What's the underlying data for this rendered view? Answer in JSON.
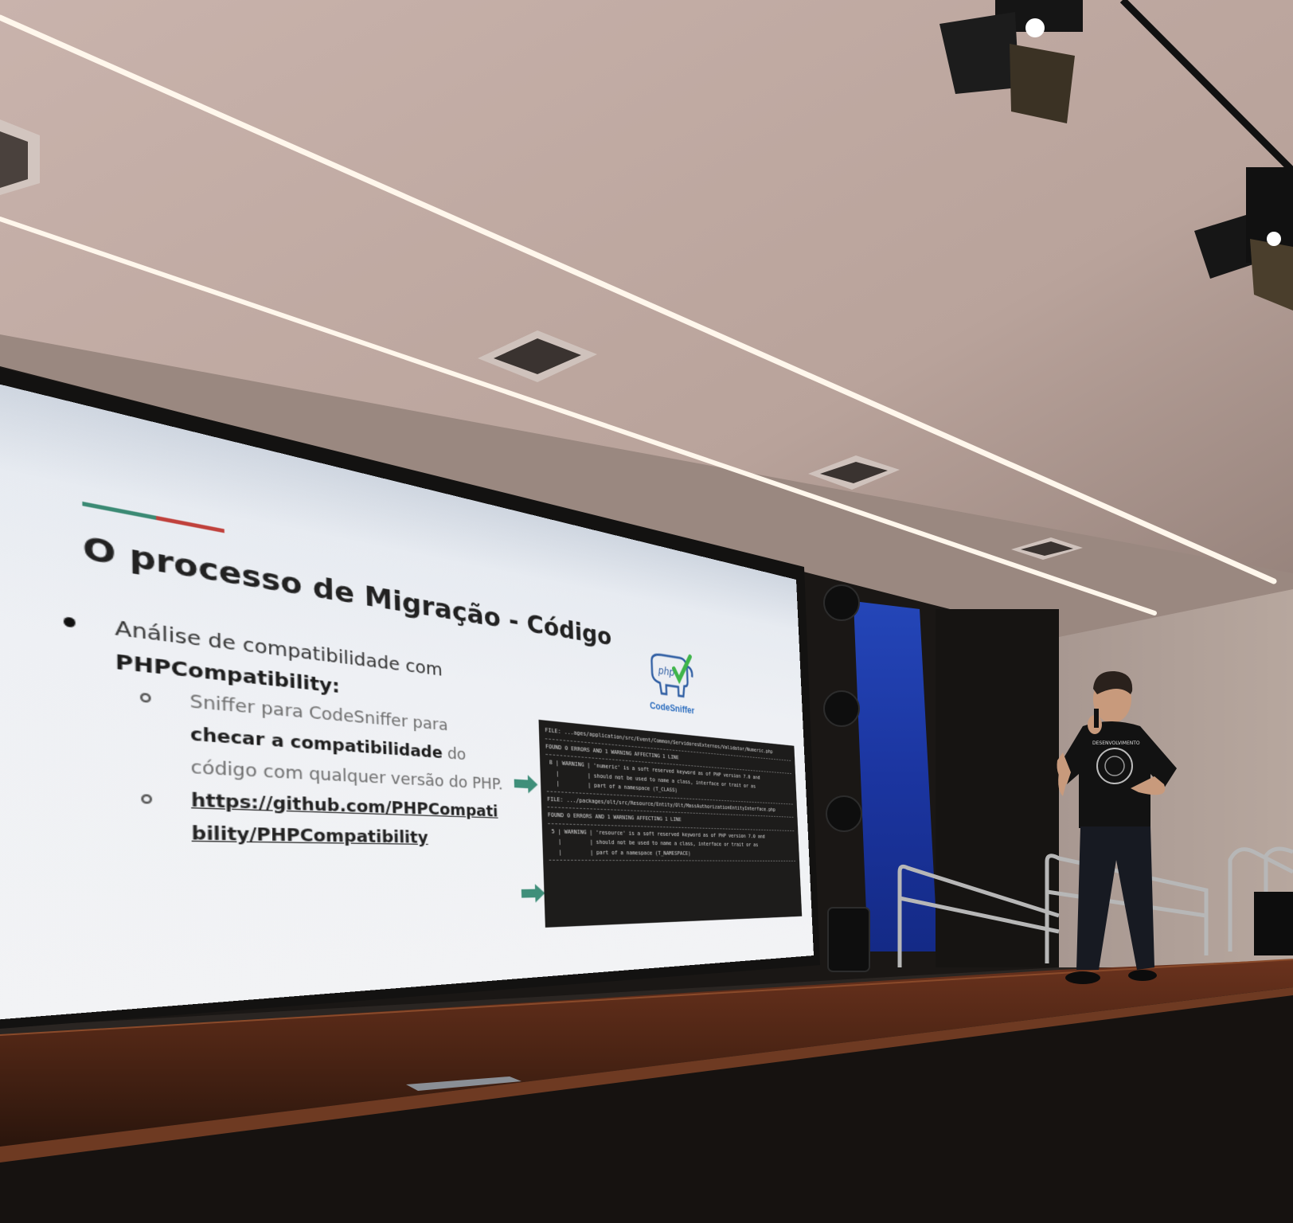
{
  "slide": {
    "title": "O processo de Migração - Código",
    "bullet_lead": "Análise de compatibilidade com",
    "bullet_strong": "PHPCompatibility:",
    "sub1_pre": "Sniffer para CodeSniffer para",
    "sub1_strong": "checar a compatibilidade",
    "sub1_post": "do código com qualquer versão do PHP.",
    "link": "https://github.com/PHPCompatibility/PHPCompatibility",
    "logo_text": "php",
    "logo_name": "CodeSniffer",
    "accent_colors": [
      "#3b8a74",
      "#c0413c"
    ]
  },
  "terminal": {
    "lines": [
      "FILE: ...ages/application/src/Event/Common/ServidoresExternos/Validator/Numeric.php",
      "---",
      "FOUND 0 ERRORS AND 1 WARNING AFFECTING 1 LINE",
      "---",
      " 8 | WARNING | 'numeric' is a soft reserved keyword as of PHP version 7.0 and",
      "   |         | should not be used to name a class, interface or trait or as",
      "   |         | part of a namespace (T_CLASS)",
      "---",
      "FILE: .../packages/olt/src/Resource/Entity/Olt/MassAuthorizationEntityInterface.php",
      "---",
      "FOUND 0 ERRORS AND 1 WARNING AFFECTING 1 LINE",
      "---",
      " 5 | WARNING | 'resource' is a soft reserved keyword as of PHP version 7.0 and",
      "   |         | should not be used to name a class, interface or trait or as",
      "   |         | part of a namespace (T_NAMESPACE)",
      "---"
    ]
  },
  "speaker_shirt": "DESENVOLVIMENTO",
  "colors": {
    "ceiling": "#c7b3ad",
    "wall": "#a99890",
    "stage": "#5a2d1a",
    "screen_frame": "#151412",
    "led_panel": "#1d3aa8"
  }
}
